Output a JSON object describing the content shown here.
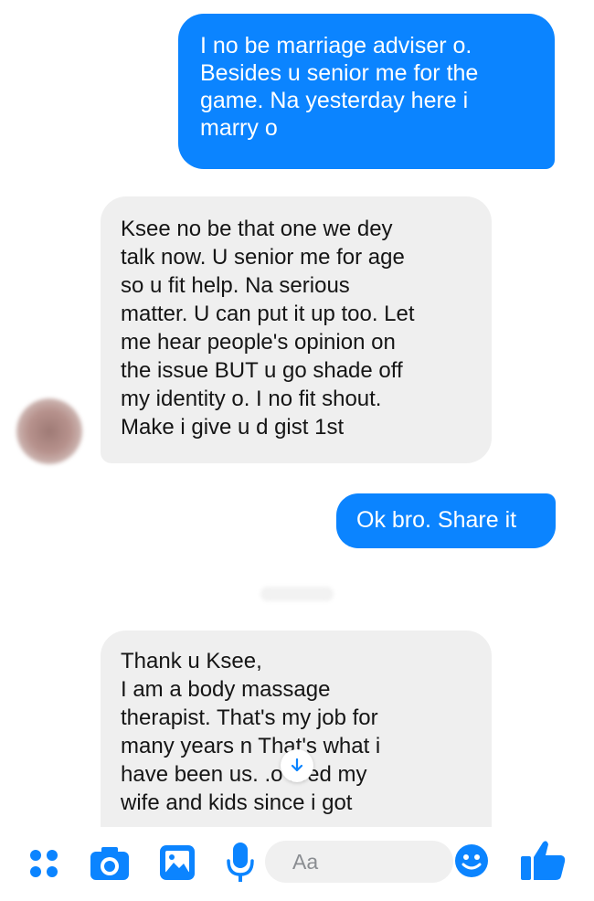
{
  "thread": {
    "messages": [
      {
        "id": "msg1",
        "direction": "sent",
        "text": "I no be marriage adviser o.\nBesides u senior me for the\ngame. Na yesterday here i\nmarry o"
      },
      {
        "id": "msg2",
        "direction": "received",
        "text": "Ksee no be that one we dey\ntalk now. U senior me for age\nso u fit help. Na serious\nmatter. U can put it up too. Let\nme hear people's opinion on\nthe issue BUT u go shade off\nmy identity o. I no fit shout.\nMake i give u d gist 1st"
      },
      {
        "id": "msg3",
        "direction": "sent",
        "text": "Ok bro. Share it"
      },
      {
        "id": "msg4",
        "direction": "received",
        "text": "Thank u Ksee,\nI am a body massage\ntherapist. That's my job for\nmany years n       That's what i\nhave been us.       .o feed my\nwife and kids since i got"
      }
    ]
  },
  "composer": {
    "placeholder": "Aa",
    "icons": [
      "apps-icon",
      "camera-icon",
      "gallery-icon",
      "microphone-icon",
      "emoji-icon",
      "like-icon"
    ]
  },
  "colors": {
    "sent_bubble": "#0b84ff",
    "received_bubble": "#efefef",
    "accent": "#0b84ff"
  }
}
